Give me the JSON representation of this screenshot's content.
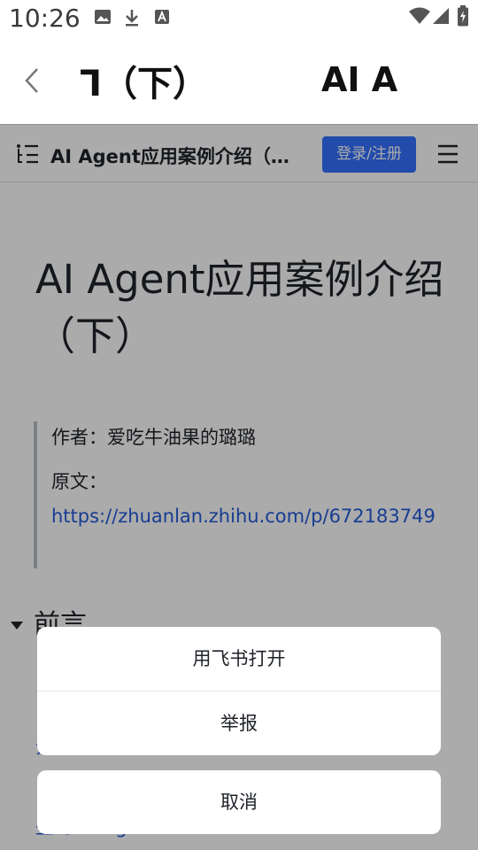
{
  "status_bar": {
    "time": "10:26"
  },
  "title_bar": {
    "title_left": "ᒣ（下）",
    "title_right": "AI A"
  },
  "web_header": {
    "doc_title": "AI Agent应用案例介绍（下）",
    "login_label": "登录/注册"
  },
  "document": {
    "heading": "AI Agent应用案例介绍（下）",
    "author": "作者：爱吃牛油果的璐璐",
    "source_label": "原文：",
    "source_url": "https://zhuanlan.zhihu.com/p/672183749",
    "section_title": "前言",
    "toc_fragments": [
      "介绍",
      "些的 AI Agents"
    ]
  },
  "action_sheet": {
    "open_in_feishu": "用飞书打开",
    "report": "举报",
    "cancel": "取消"
  }
}
